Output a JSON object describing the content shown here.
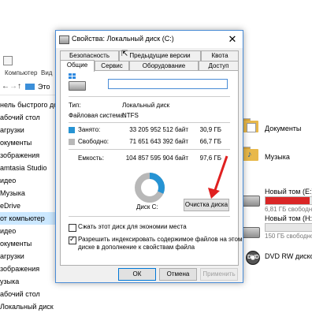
{
  "explorer": {
    "tabs": [
      "Компьютер",
      "Вид"
    ],
    "address": {
      "text": "Это"
    },
    "nav_items": [
      {
        "label": "нель быстрого дост",
        "selected": false
      },
      {
        "label": "абочий стол",
        "selected": false
      },
      {
        "label": "агрузки",
        "selected": false
      },
      {
        "label": "окументы",
        "selected": false
      },
      {
        "label": "зображения",
        "selected": false
      },
      {
        "label": "amtasia Studio",
        "selected": false
      },
      {
        "label": "идео",
        "selected": false
      },
      {
        "label": "Музыка",
        "selected": false
      },
      {
        "label": "eDrive",
        "selected": false
      },
      {
        "label": "от компьютер",
        "selected": true
      },
      {
        "label": "идео",
        "selected": false
      },
      {
        "label": "окументы",
        "selected": false
      },
      {
        "label": "агрузки",
        "selected": false
      },
      {
        "label": "зображения",
        "selected": false
      },
      {
        "label": "узыка",
        "selected": false
      },
      {
        "label": "абочий стол",
        "selected": false
      },
      {
        "label": "Локальный диск (C:)",
        "selected": false
      }
    ],
    "folders": [
      {
        "label": "Документы"
      },
      {
        "label": "Музыка"
      }
    ],
    "drives": [
      {
        "label": "Новый том (E:)",
        "free": "6,81 ГБ свободно",
        "used_fraction": 0.93,
        "bar_color": "#da2626"
      },
      {
        "label": "Новый том (H:)",
        "free": "150 ГБ свободно",
        "used_fraction": 0.0,
        "bar_color": "#26a0da"
      },
      {
        "label": "DVD RW дисковод",
        "dvd_text": "DVD"
      }
    ]
  },
  "dialog": {
    "title": "Свойства: Локальный диск (C:)",
    "close": "✕",
    "tabs_row1": [
      "Безопасность",
      "Предыдущие версии",
      "Квота"
    ],
    "tabs_row2": [
      "Общие",
      "Сервис",
      "Оборудование",
      "Доступ"
    ],
    "active_tab": "Общие",
    "label_value": "",
    "type_label": "Тип:",
    "type_value": "Локальный диск",
    "fs_label": "Файловая система:",
    "fs_value": "NTFS",
    "used_label": "Занято:",
    "used_bytes": "33 205 952 512 байт",
    "used_gb": "30,9 ГБ",
    "free_label": "Свободно:",
    "free_bytes": "71 651 643 392 байт",
    "free_gb": "66,7 ГБ",
    "capacity_label": "Емкость:",
    "capacity_bytes": "104 857 595 904 байт",
    "capacity_gb": "97,6 ГБ",
    "used_fraction": 0.317,
    "used_color": "#2693d3",
    "free_color": "#b8b8b8",
    "disk_label": "Диск C:",
    "cleanup_button": "Очистка диска",
    "compress_label": "Сжать этот диск для экономии места",
    "compress_checked": false,
    "index_label_1": "Разрешить индексировать содержимое файлов на этом",
    "index_label_2": "диске в дополнение к свойствам файла",
    "index_checked": true,
    "ok": "ОК",
    "cancel": "Отмена",
    "apply": "Применить"
  },
  "colors": {
    "accent": "#0078d7",
    "arrow": "#e02020"
  }
}
